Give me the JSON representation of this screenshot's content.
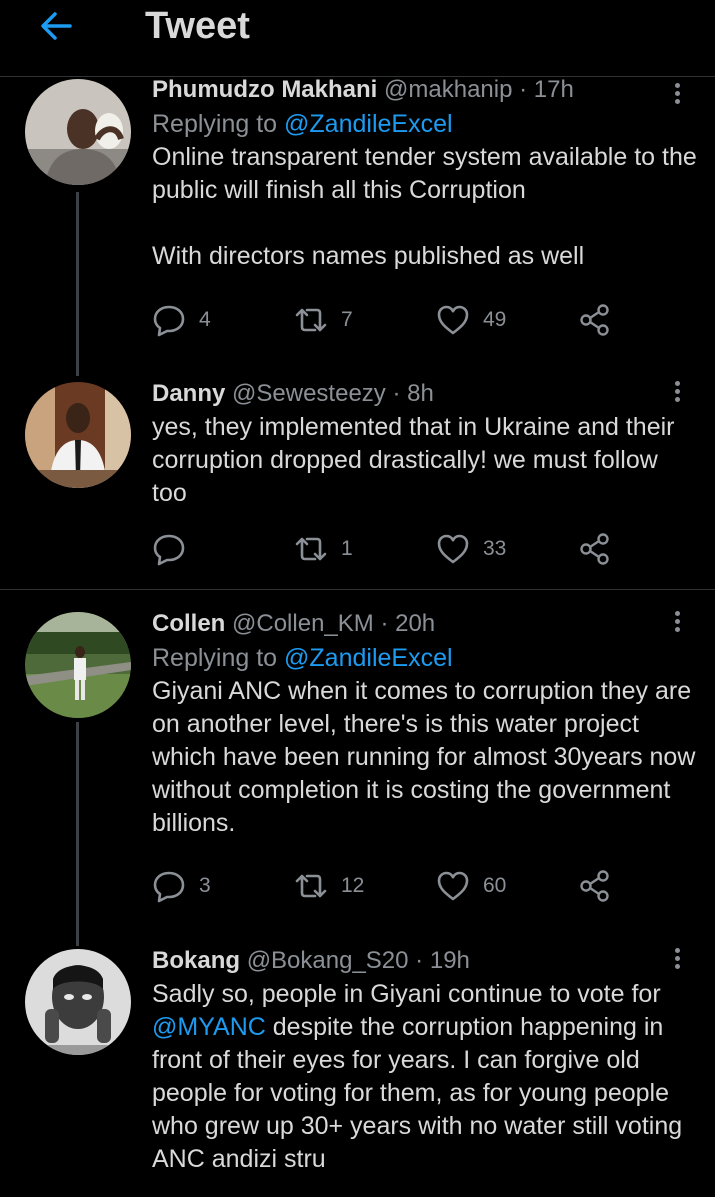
{
  "header": {
    "title": "Tweet",
    "back_icon": "arrow-left-icon",
    "accent": "#1d9bf0"
  },
  "tweets": [
    {
      "name": "Phumudzo Makhani",
      "handle": "@makhanip",
      "dot": "·",
      "time": "17h",
      "replying_prefix": "Replying to ",
      "replying_to": "@ZandileExcel",
      "body": "Online transparent tender system available to the public will finish all this Corruption",
      "body2": "With directors names published as well",
      "replies": "4",
      "retweets": "7",
      "likes": "49"
    },
    {
      "name": "Danny",
      "handle": "@Sewesteezy",
      "dot": "·",
      "time": "8h",
      "body": "yes, they implemented that in Ukraine and their corruption dropped drastically! we must follow too",
      "replies": "",
      "retweets": "1",
      "likes": "33"
    },
    {
      "name": "Collen",
      "handle": "@Collen_KM",
      "dot": "·",
      "time": "20h",
      "replying_prefix": "Replying to ",
      "replying_to": "@ZandileExcel",
      "body": "Giyani ANC when it comes to corruption they are on another level, there's is this water project which have been running for almost 30years now without completion it is costing the government billions.",
      "replies": "3",
      "retweets": "12",
      "likes": "60"
    },
    {
      "name": "Bokang",
      "handle": "@Bokang_S20",
      "dot": "·",
      "time": "19h",
      "body_prefix": "Sadly so, people in Giyani continue to vote for ",
      "mention": "@MYANC",
      "body_suffix": " despite the corruption happening in front of their eyes for years. I can forgive old people for voting for them, as for young people who grew up 30+ years with no water still voting ANC andizi stru"
    }
  ]
}
